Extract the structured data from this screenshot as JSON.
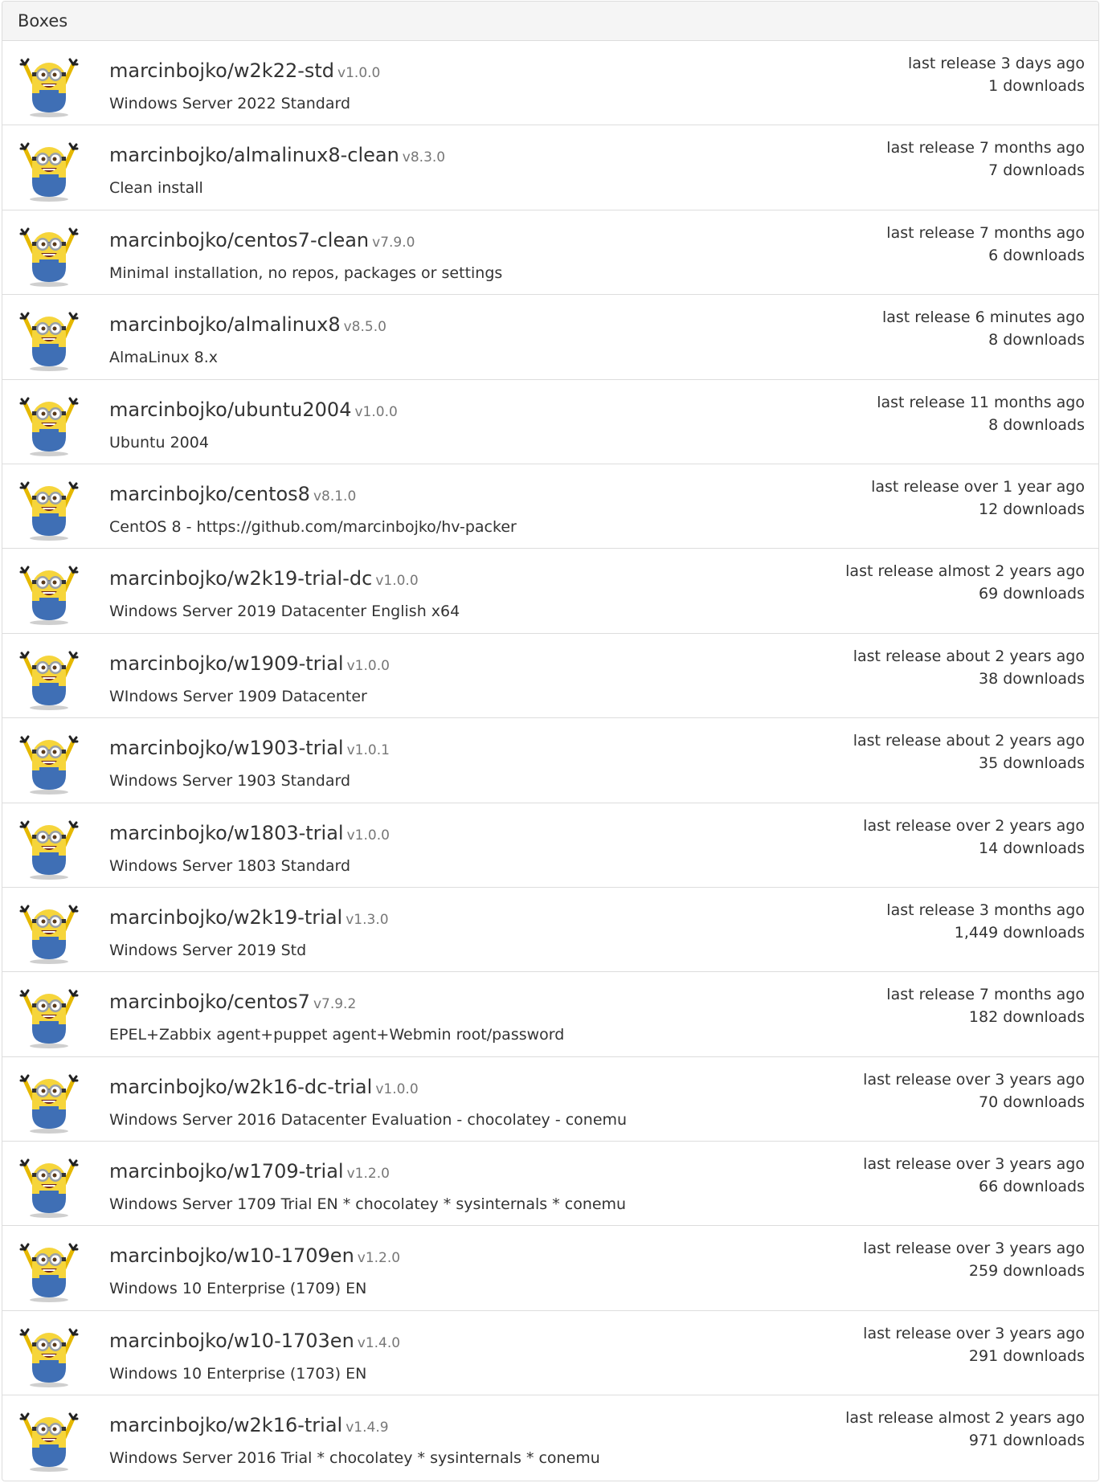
{
  "panel": {
    "title": "Boxes"
  },
  "boxes": [
    {
      "name": "marcinbojko/w2k22-std",
      "version": "v1.0.0",
      "description": "Windows Server 2022 Standard",
      "release": "last release 3 days ago",
      "downloads": "1 downloads"
    },
    {
      "name": "marcinbojko/almalinux8-clean",
      "version": "v8.3.0",
      "description": "Clean install",
      "release": "last release 7 months ago",
      "downloads": "7 downloads"
    },
    {
      "name": "marcinbojko/centos7-clean",
      "version": "v7.9.0",
      "description": "Minimal installation, no repos, packages or settings",
      "release": "last release 7 months ago",
      "downloads": "6 downloads"
    },
    {
      "name": "marcinbojko/almalinux8",
      "version": "v8.5.0",
      "description": "AlmaLinux 8.x",
      "release": "last release 6 minutes ago",
      "downloads": "8 downloads"
    },
    {
      "name": "marcinbojko/ubuntu2004",
      "version": "v1.0.0",
      "description": "Ubuntu 2004",
      "release": "last release 11 months ago",
      "downloads": "8 downloads"
    },
    {
      "name": "marcinbojko/centos8",
      "version": "v8.1.0",
      "description": "CentOS 8 - https://github.com/marcinbojko/hv-packer",
      "release": "last release over 1 year ago",
      "downloads": "12 downloads"
    },
    {
      "name": "marcinbojko/w2k19-trial-dc",
      "version": "v1.0.0",
      "description": "Windows Server 2019 Datacenter English x64",
      "release": "last release almost 2 years ago",
      "downloads": "69 downloads"
    },
    {
      "name": "marcinbojko/w1909-trial",
      "version": "v1.0.0",
      "description": "WIndows Server 1909 Datacenter",
      "release": "last release about 2 years ago",
      "downloads": "38 downloads"
    },
    {
      "name": "marcinbojko/w1903-trial",
      "version": "v1.0.1",
      "description": "Windows Server 1903 Standard",
      "release": "last release about 2 years ago",
      "downloads": "35 downloads"
    },
    {
      "name": "marcinbojko/w1803-trial",
      "version": "v1.0.0",
      "description": "Windows Server 1803 Standard",
      "release": "last release over 2 years ago",
      "downloads": "14 downloads"
    },
    {
      "name": "marcinbojko/w2k19-trial",
      "version": "v1.3.0",
      "description": "Windows Server 2019 Std",
      "release": "last release 3 months ago",
      "downloads": "1,449 downloads"
    },
    {
      "name": "marcinbojko/centos7",
      "version": "v7.9.2",
      "description": "EPEL+Zabbix agent+puppet agent+Webmin root/password",
      "release": "last release 7 months ago",
      "downloads": "182 downloads"
    },
    {
      "name": "marcinbojko/w2k16-dc-trial",
      "version": "v1.0.0",
      "description": "Windows Server 2016 Datacenter Evaluation - chocolatey - conemu",
      "release": "last release over 3 years ago",
      "downloads": "70 downloads"
    },
    {
      "name": "marcinbojko/w1709-trial",
      "version": "v1.2.0",
      "description": "Windows Server 1709 Trial EN * chocolatey * sysinternals * conemu",
      "release": "last release over 3 years ago",
      "downloads": "66 downloads"
    },
    {
      "name": "marcinbojko/w10-1709en",
      "version": "v1.2.0",
      "description": "Windows 10 Enterprise (1709) EN",
      "release": "last release over 3 years ago",
      "downloads": "259 downloads"
    },
    {
      "name": "marcinbojko/w10-1703en",
      "version": "v1.4.0",
      "description": "Windows 10 Enterprise (1703) EN",
      "release": "last release over 3 years ago",
      "downloads": "291 downloads"
    },
    {
      "name": "marcinbojko/w2k16-trial",
      "version": "v1.4.9",
      "description": "Windows Server 2016 Trial * chocolatey * sysinternals * conemu",
      "release": "last release almost 2 years ago",
      "downloads": "971 downloads"
    }
  ]
}
